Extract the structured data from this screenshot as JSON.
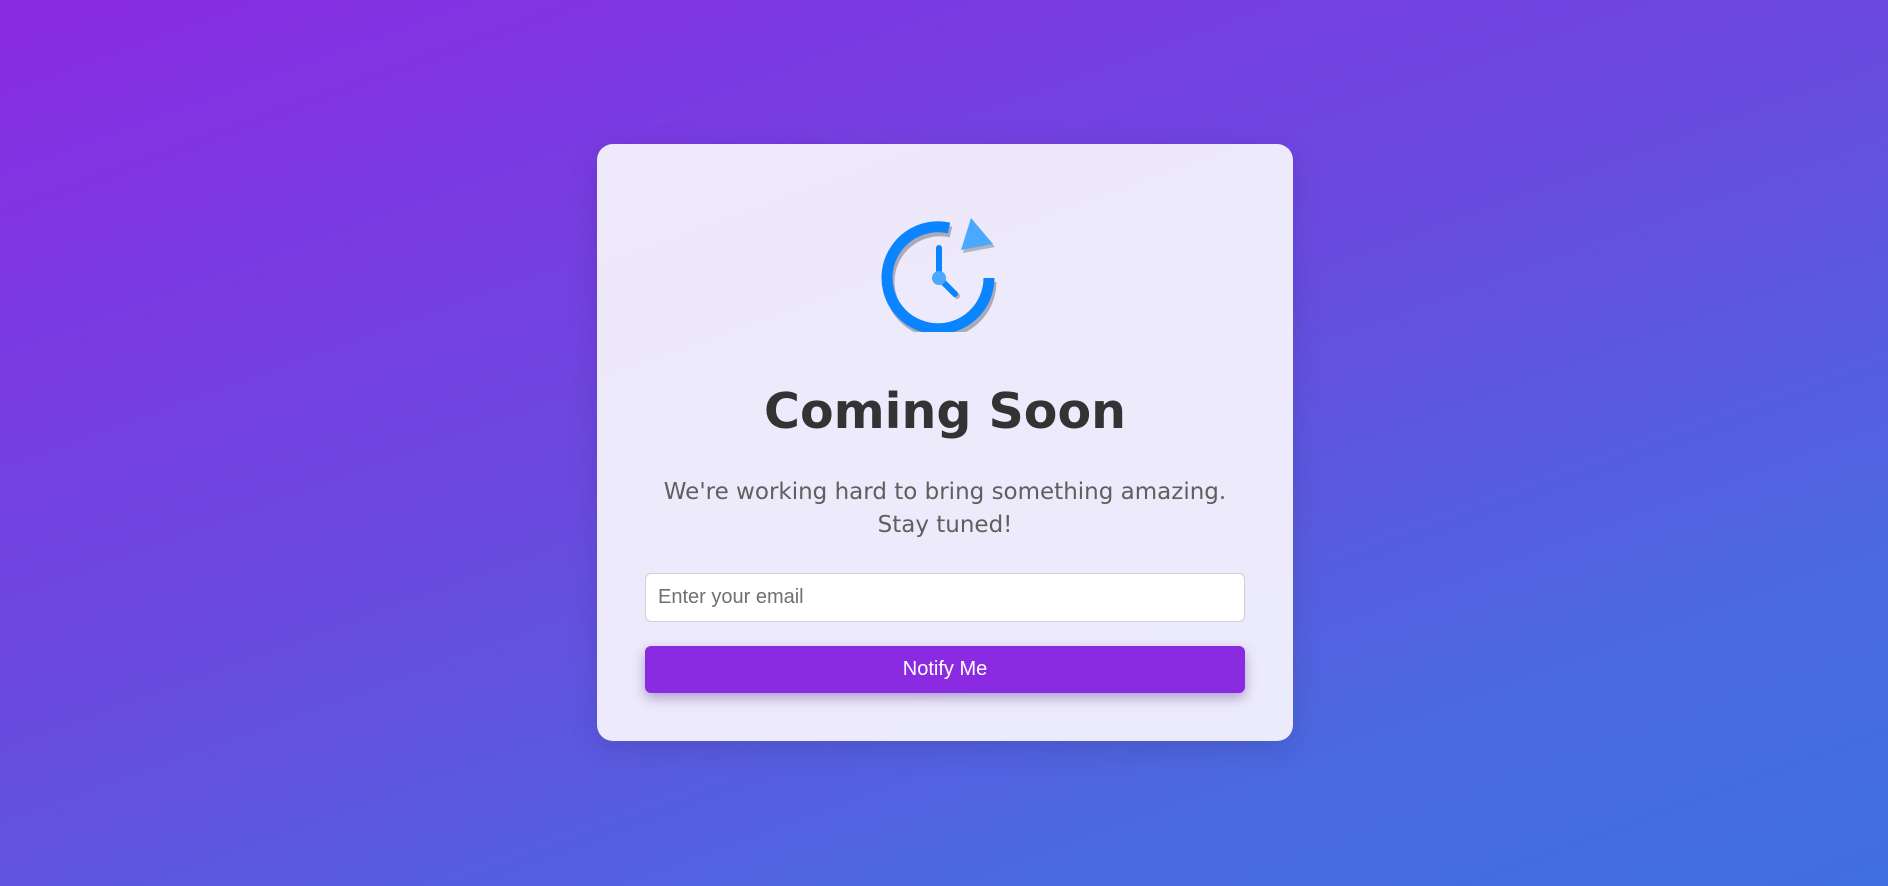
{
  "card": {
    "icon": "clock-refresh-icon",
    "title": "Coming Soon",
    "subtitle": "We're working hard to bring something amazing. Stay tuned!"
  },
  "form": {
    "email_placeholder": "Enter your email",
    "email_value": "",
    "notify_label": "Notify Me"
  },
  "colors": {
    "gradient_start": "#8a2be2",
    "gradient_end": "#3f6fe0",
    "button": "#8a2be2",
    "icon_blue": "#0a84ff",
    "icon_light_blue": "#4aa8ff",
    "title_text": "#333333"
  }
}
